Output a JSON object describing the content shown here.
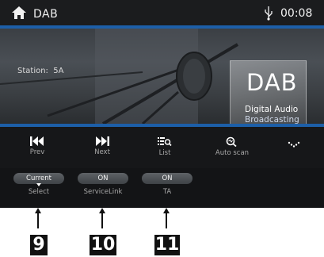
{
  "header": {
    "title": "DAB",
    "time": "00:08",
    "icons": [
      "home-icon",
      "usb-icon"
    ]
  },
  "now_playing": {
    "station_label": "Station:",
    "station_value": "5A",
    "logo": {
      "main": "DAB",
      "line1": "Digital Audio",
      "line2": "Broadcasting"
    }
  },
  "controls": [
    {
      "label": "Prev",
      "icon": "skip-back-icon"
    },
    {
      "label": "Next",
      "icon": "skip-forward-icon"
    },
    {
      "label": "List",
      "icon": "list-search-icon"
    },
    {
      "label": "Auto scan",
      "icon": "scan-icon"
    },
    {
      "label": "",
      "icon": "more-chevron-icon"
    }
  ],
  "options": [
    {
      "value": "Current",
      "label": "Select"
    },
    {
      "value": "ON",
      "label": "ServiceLink"
    },
    {
      "value": "ON",
      "label": "TA"
    }
  ],
  "callouts": [
    "9",
    "10",
    "11"
  ],
  "colors": {
    "accent_blue": "#1d5fa8",
    "background": "#111214",
    "callout_bg": "#111111"
  }
}
